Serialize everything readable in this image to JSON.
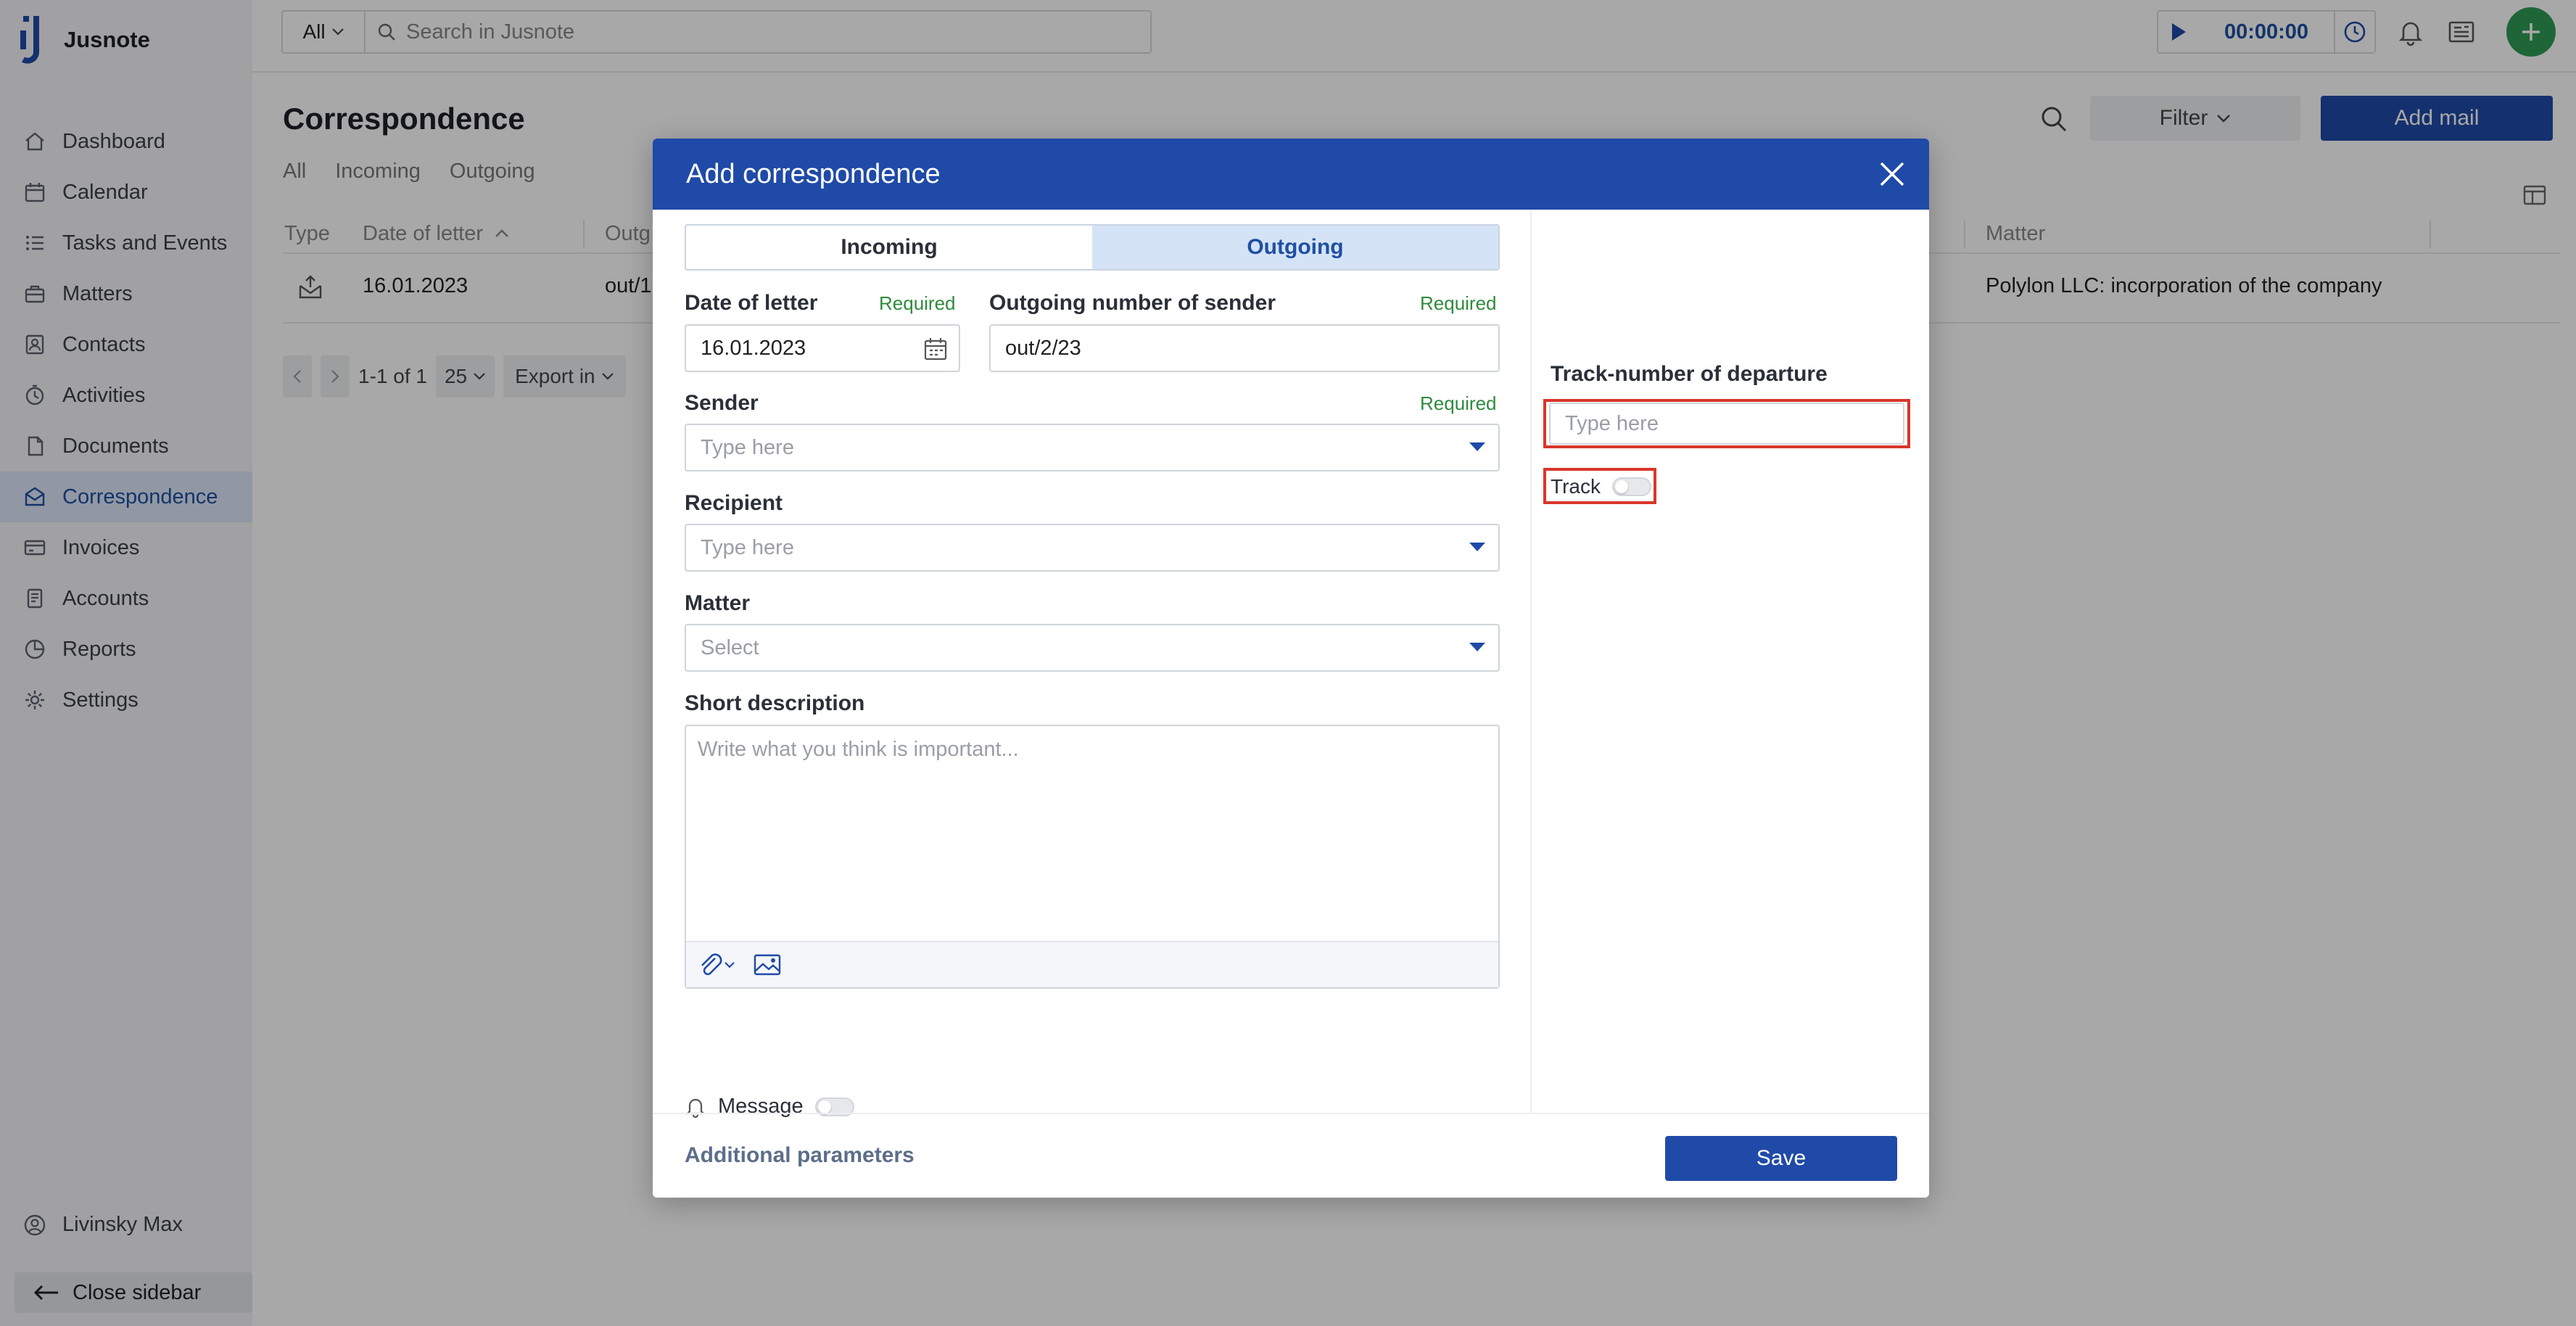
{
  "app": {
    "name": "Jusnote"
  },
  "topbar": {
    "scope": "All",
    "search_placeholder": "Search in Jusnote",
    "timer": "00:00:00"
  },
  "sidebar": {
    "items": [
      {
        "label": "Dashboard",
        "icon": "home-icon"
      },
      {
        "label": "Calendar",
        "icon": "calendar-icon"
      },
      {
        "label": "Tasks and Events",
        "icon": "tasks-icon"
      },
      {
        "label": "Matters",
        "icon": "briefcase-icon"
      },
      {
        "label": "Contacts",
        "icon": "contacts-icon"
      },
      {
        "label": "Activities",
        "icon": "activities-icon"
      },
      {
        "label": "Documents",
        "icon": "documents-icon"
      },
      {
        "label": "Correspondence",
        "icon": "correspondence-icon",
        "active": true
      },
      {
        "label": "Invoices",
        "icon": "invoices-icon"
      },
      {
        "label": "Accounts",
        "icon": "accounts-icon"
      },
      {
        "label": "Reports",
        "icon": "reports-icon"
      },
      {
        "label": "Settings",
        "icon": "gear-icon"
      }
    ],
    "user": "Livinsky Max",
    "close_label": "Close sidebar"
  },
  "page": {
    "title": "Correspondence",
    "tabs": [
      "All",
      "Incoming",
      "Outgoing"
    ],
    "filter_label": "Filter",
    "add_label": "Add mail",
    "table": {
      "headers": {
        "type": "Type",
        "date": "Date of letter",
        "outg": "Outg",
        "matter": "Matter"
      },
      "row": {
        "date": "16.01.2023",
        "outg": "out/1",
        "matter": "Polylon LLC: incorporation of the company"
      }
    },
    "pager": {
      "range": "1-1 of 1",
      "per_page": "25",
      "export": "Export in"
    }
  },
  "modal": {
    "title": "Add correspondence",
    "tabs": {
      "incoming": "Incoming",
      "outgoing": "Outgoing"
    },
    "required": "Required",
    "date_label": "Date of letter",
    "date_value": "16.01.2023",
    "outgoing_label": "Outgoing number of sender",
    "outgoing_value": "out/2/23",
    "sender_label": "Sender",
    "sender_placeholder": "Type here",
    "recipient_label": "Recipient",
    "recipient_placeholder": "Type here",
    "matter_label": "Matter",
    "matter_placeholder": "Select",
    "desc_label": "Short description",
    "desc_placeholder": "Write what you think is important...",
    "message_label": "Message",
    "track_number_label": "Track-number of departure",
    "track_number_placeholder": "Type here",
    "track_label": "Track",
    "additional": "Additional parameters",
    "save": "Save"
  },
  "colors": {
    "primary": "#1f4aa8",
    "required": "#2e8b3d",
    "highlight": "#d9362b",
    "add_button": "#2e9c56"
  }
}
